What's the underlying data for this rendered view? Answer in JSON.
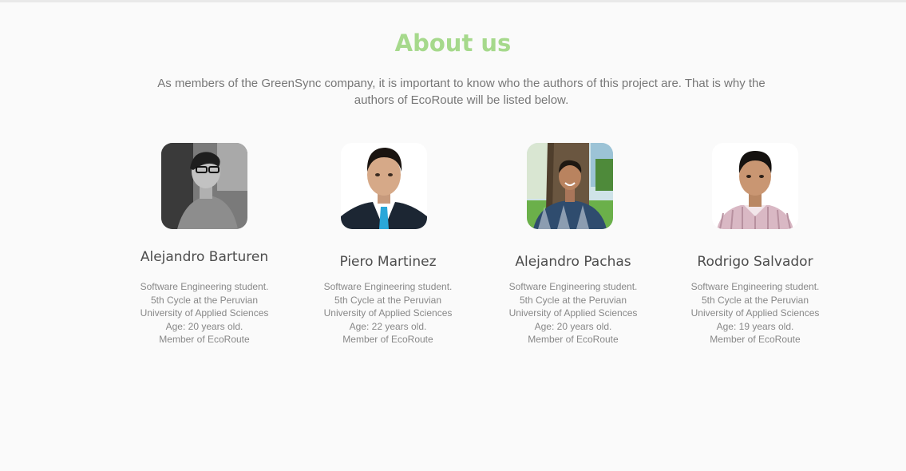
{
  "section": {
    "title": "About us",
    "intro": "As members of the GreenSync company, it is important to know who the authors of this project are. That is why the authors of EcoRoute will be listed below."
  },
  "members": [
    {
      "name": "Alejandro Barturen",
      "info": [
        "Software Engineering student.",
        "5th Cycle at the Peruvian",
        "University of Applied Sciences",
        "Age: 20 years old.",
        "Member of EcoRoute"
      ]
    },
    {
      "name": "Piero Martinez",
      "info": [
        "Software Engineering student.",
        "5th Cycle at the Peruvian",
        "University of Applied Sciences",
        "Age: 22 years old.",
        "Member of EcoRoute"
      ]
    },
    {
      "name": "Alejandro Pachas",
      "info": [
        "Software Engineering student.",
        "5th Cycle at the Peruvian",
        "University of Applied Sciences",
        "Age: 20 years old.",
        "Member of EcoRoute"
      ]
    },
    {
      "name": "Rodrigo Salvador",
      "info": [
        "Software Engineering student.",
        "5th Cycle at the Peruvian",
        "University of Applied Sciences",
        "Age: 19 years old.",
        "Member of EcoRoute"
      ]
    }
  ],
  "colors": {
    "title": "#a6d98c",
    "background": "#fafafa",
    "body_text": "#777777",
    "name_text": "#4d4d4d"
  }
}
